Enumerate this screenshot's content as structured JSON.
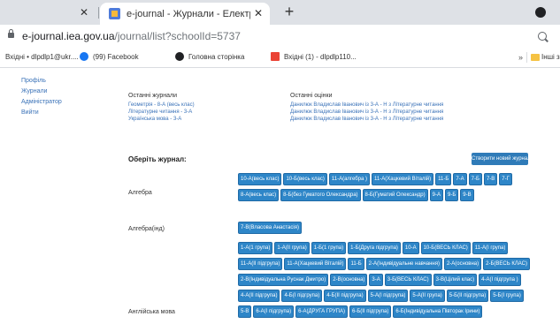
{
  "browser": {
    "prev_tab_close": "✕",
    "active_tab": {
      "title": "e-journal - Журнали - Електронні ш",
      "close": "✕"
    },
    "new_tab": "+",
    "url_domain": "e-journal.iea.gov.ua",
    "url_path": "/journal/list?schoolId=5737",
    "bookmarks": [
      {
        "label": "Вхідні • dlpdlp1@ukr....",
        "color": ""
      },
      {
        "label": "(99) Facebook",
        "color": "#1877f2"
      },
      {
        "label": "Головна сторінка",
        "color": "#202124"
      },
      {
        "label": "Вхідні (1) - dlpdlp110...",
        "color": "#ea4335"
      }
    ],
    "bookmarks_more": "»",
    "other_bookmarks": "Інші закладки"
  },
  "sidebar": {
    "items": [
      "Профіль",
      "Журнали",
      "Адміністратор",
      "Вийти"
    ]
  },
  "recent_journals": {
    "header": "Останні журнали",
    "items": [
      "Геометрія - 8-А (весь клас)",
      "Літературне читання - 3-А",
      "Українська мова - 3-А"
    ]
  },
  "recent_grades": {
    "header": "Останні оцінки",
    "items": [
      "Данилюк Владислав Іванович із 3-А - Н з Літературне читання",
      "Данилюк Владислав Іванович із 3-А - Н з Літературне читання",
      "Данилюк Владислав Іванович із 3-А - Н з Літературне читання"
    ]
  },
  "choose_label": "Оберіть журнал:",
  "create_button": "Створити новий журнал",
  "subjects": [
    {
      "name": "Алгебра",
      "journals": [
        "10-А(весь клас)",
        "10-Б(весь клас)",
        "11-А(алгебра )",
        "11-А(Хацкевий Віталій)",
        "11-Б",
        "7-А",
        "7-Б",
        "7-В",
        "7-Г",
        "8-А(весь клас)",
        "8-Б(без Гуматого Олександра)",
        "8-Б(Гуматий Олександр)",
        "9-А",
        "9-Б",
        "9-В"
      ]
    },
    {
      "name": "Алгебра(інд)",
      "journals": [
        "7-В(Власова Анастасія)"
      ]
    },
    {
      "name": "Англійська мова",
      "journals": [
        "1-А(1 група)",
        "1-А(ІІ група)",
        "1-Б(1 група)",
        "1-Б(Друга підгрупа)",
        "10-А",
        "10-Б(ВЕСЬ КЛАС)",
        "11-А(І група)",
        "11-А(ІІ підгрупа)",
        "11-А(Хацкевий Віталій)",
        "11-Б",
        "2-А(Індивідуальне навчання)",
        "2-А(основна)",
        "2-Б(ВЕСЬ КЛАС)",
        "2-В(Індивідуальна Руснак Дмитро)",
        "2-В(основна)",
        "3-А",
        "3-Б(ВЕСЬ КЛАС)",
        "3-В(Цілий клас)",
        "4-А(І підгрупа )",
        "4-А(ІІ підгрупа)",
        "4-Б(І підгрупа)",
        "4-Б(ІІ підгрупа)",
        "5-А(І підгрупа)",
        "5-А(ІІ група)",
        "5-Б(ІІ підгрупа)",
        "5-Б(І група)",
        "5-В",
        "6-А(І підгрупа)",
        "6-А(ДРУГА ГРУПА)",
        "6-Б(ІІ підгрупа)",
        "6-Б(Індивідуальна Півторак Ірини)"
      ]
    }
  ]
}
